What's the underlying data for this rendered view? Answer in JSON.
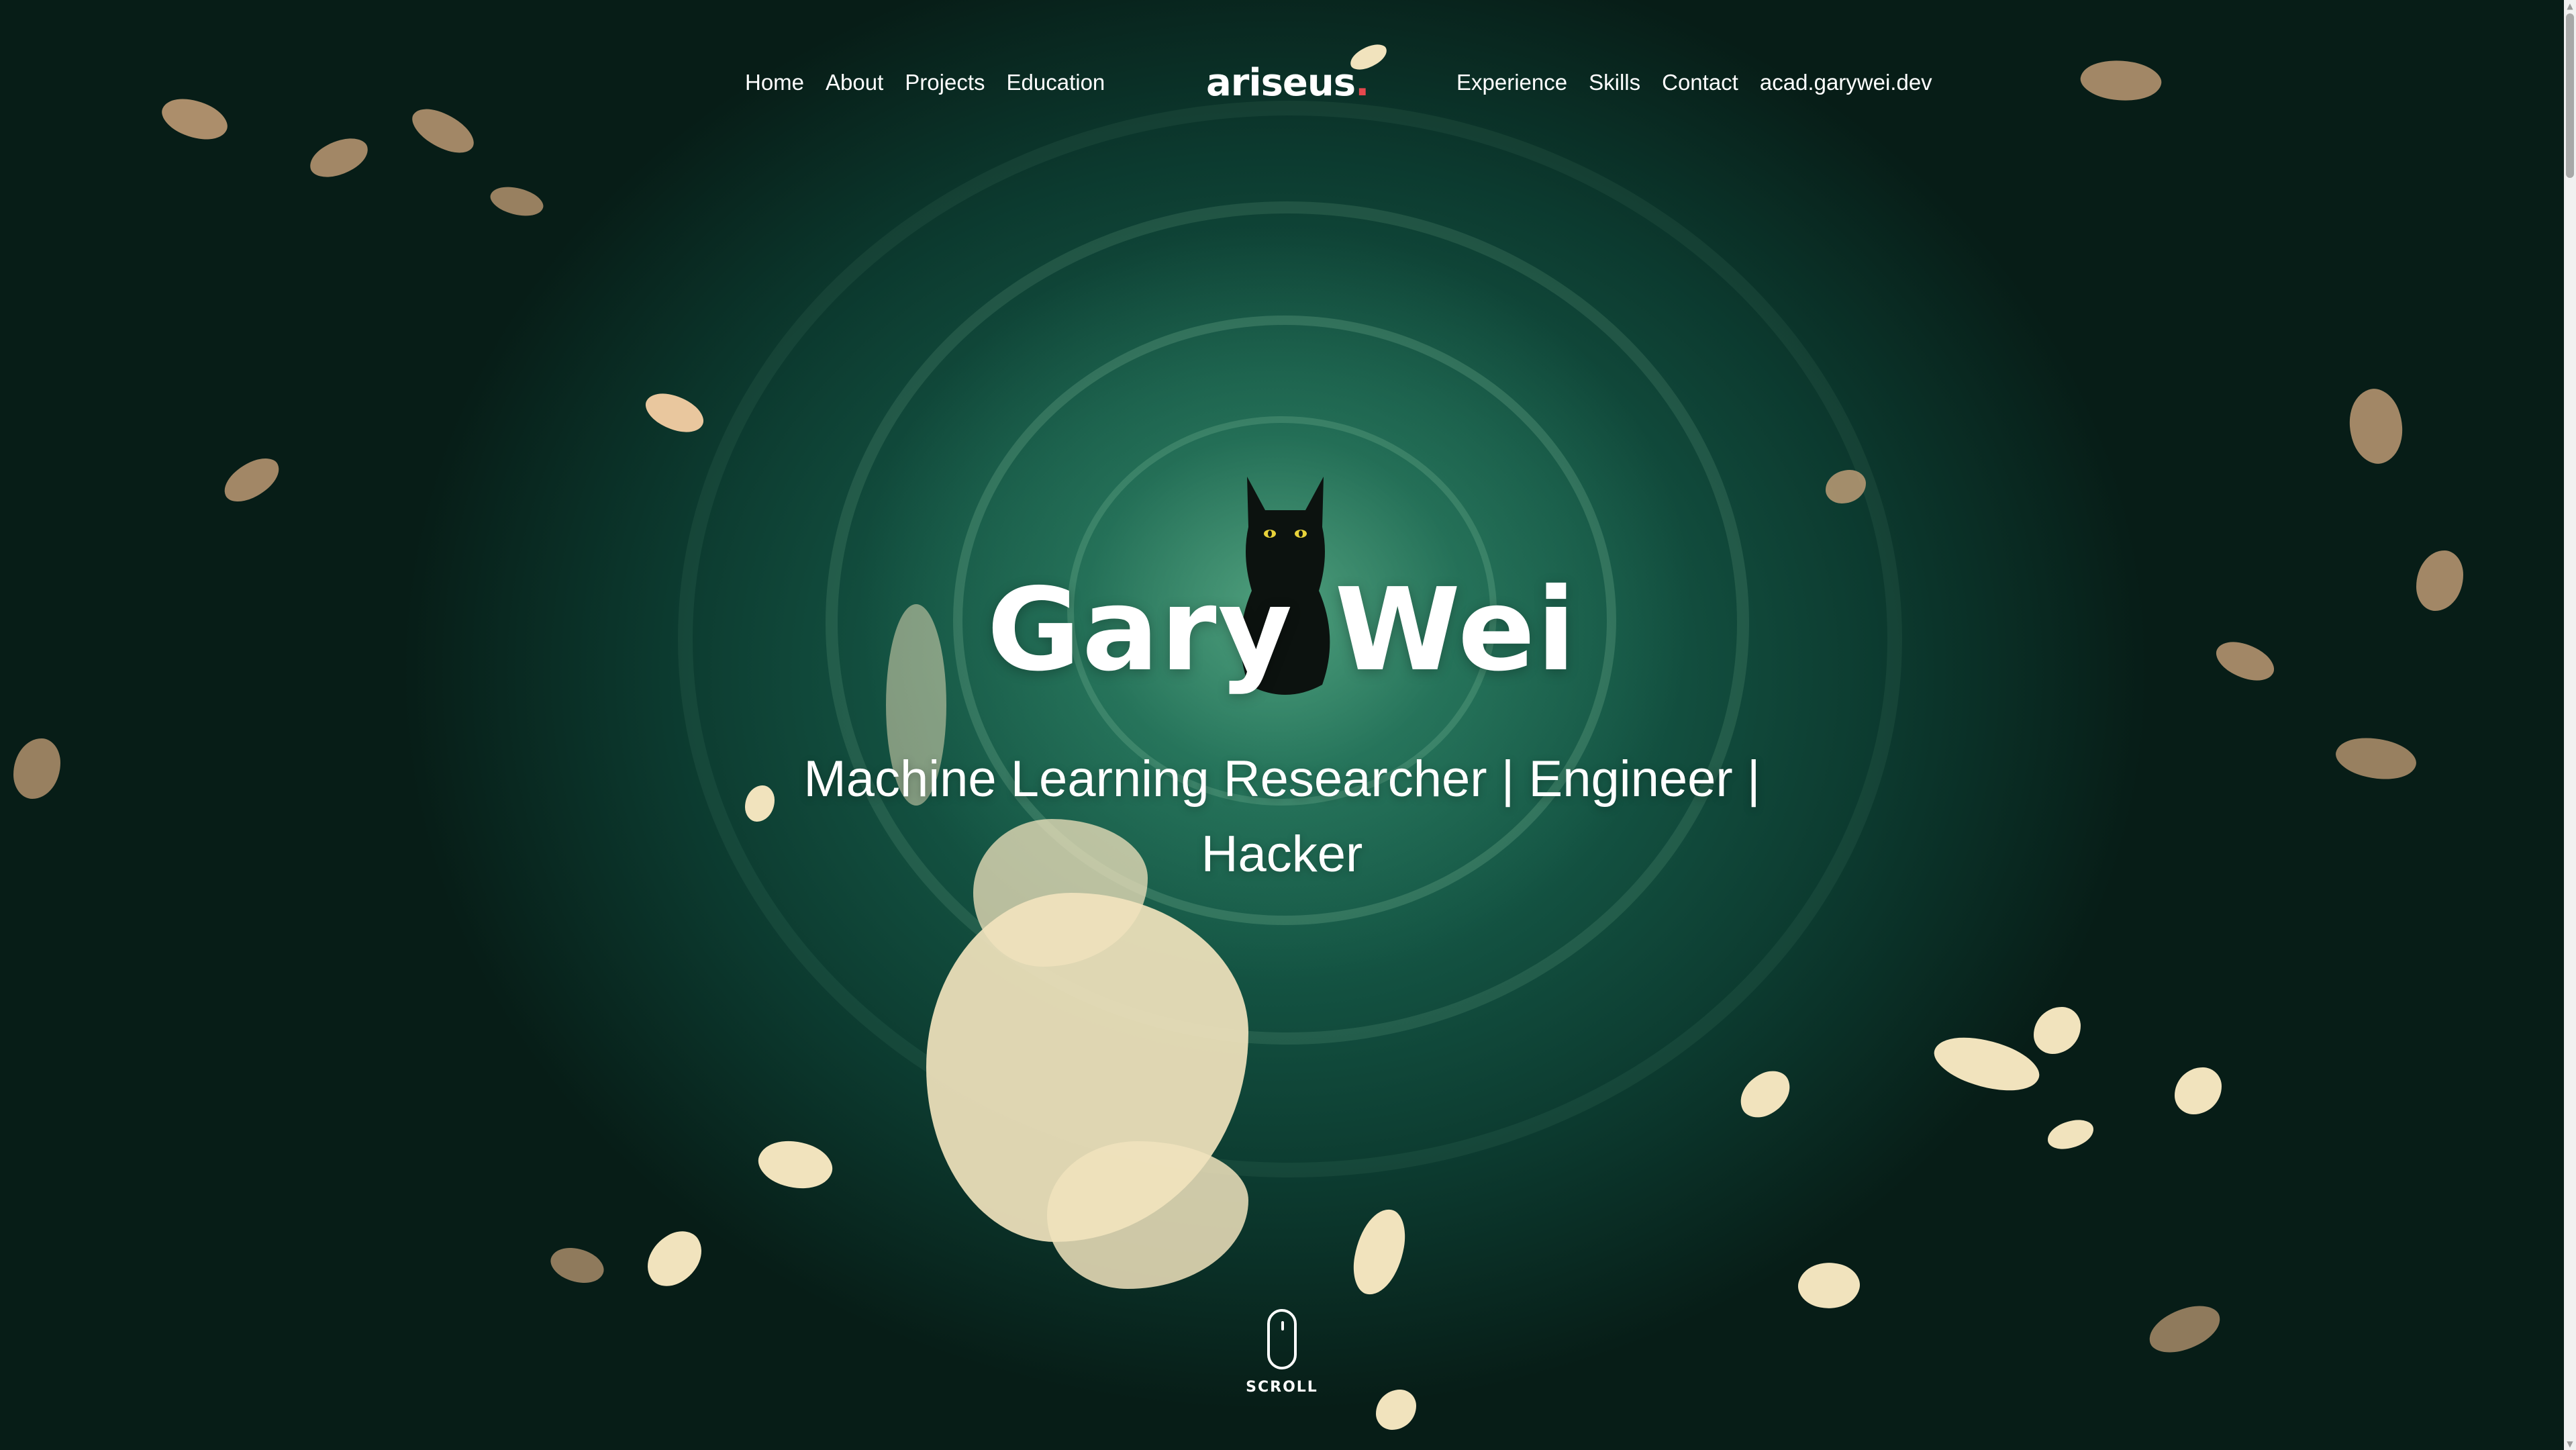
{
  "nav": {
    "left_links": [
      "Home",
      "About",
      "Projects",
      "Education"
    ],
    "right_links": [
      "Experience",
      "Skills",
      "Contact",
      "acad.garywei.dev"
    ]
  },
  "brand": {
    "name": "ariseus",
    "dot": "."
  },
  "hero": {
    "title": "Gary Wei",
    "subtitle": "Machine Learning Researcher | Engineer | Hacker"
  },
  "scroll": {
    "label": "SCROLL"
  },
  "colors": {
    "brand_dot": "#e5484d",
    "text": "#ffffff",
    "background": "#0b2a22"
  },
  "icons": {
    "scroll_indicator": "mouse-icon",
    "scrollbar_up": "arrow-up-icon",
    "scrollbar_down": "arrow-down-icon"
  }
}
